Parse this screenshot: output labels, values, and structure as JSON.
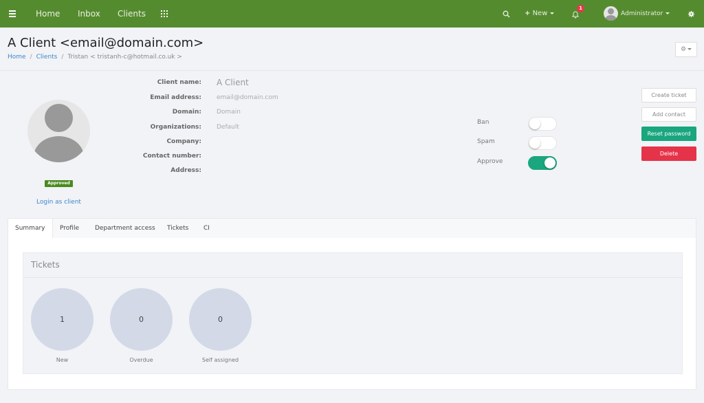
{
  "navbar": {
    "links": [
      "Home",
      "Inbox",
      "Clients"
    ],
    "new_label": "New",
    "notification_count": "1",
    "user_name": "Administrator",
    "brand_color": "#558b2f"
  },
  "header": {
    "title": "A Client <email@domain.com>",
    "breadcrumb": {
      "home": "Home",
      "clients": "Clients",
      "current": "Tristan < tristanh-c@hotmail.co.uk >"
    }
  },
  "profile": {
    "status_badge": "Approved",
    "login_as_client": "Login as client",
    "fields": [
      {
        "label": "Client name:",
        "value": "A Client"
      },
      {
        "label": "Email address:",
        "value": "email@domain.com"
      },
      {
        "label": "Domain:",
        "value": "Domain"
      },
      {
        "label": "Organizations:",
        "value": "Default"
      },
      {
        "label": "Company:",
        "value": ""
      },
      {
        "label": "Contact number:",
        "value": ""
      },
      {
        "label": "Address:",
        "value": ""
      }
    ]
  },
  "toggles": [
    {
      "label": "Ban",
      "on": false
    },
    {
      "label": "Spam",
      "on": false
    },
    {
      "label": "Approve",
      "on": true
    }
  ],
  "actions": {
    "create_ticket": "Create ticket",
    "add_contact": "Add contact",
    "reset_password": "Reset password",
    "delete": "Delete"
  },
  "tabs": [
    "Summary",
    "Profile",
    "Department access",
    "Tickets",
    "CI"
  ],
  "active_tab": "Summary",
  "tickets": {
    "title": "Tickets",
    "stats": [
      {
        "label": "New",
        "value": "1"
      },
      {
        "label": "Overdue",
        "value": "0"
      },
      {
        "label": "Self assigned",
        "value": "0"
      }
    ]
  }
}
